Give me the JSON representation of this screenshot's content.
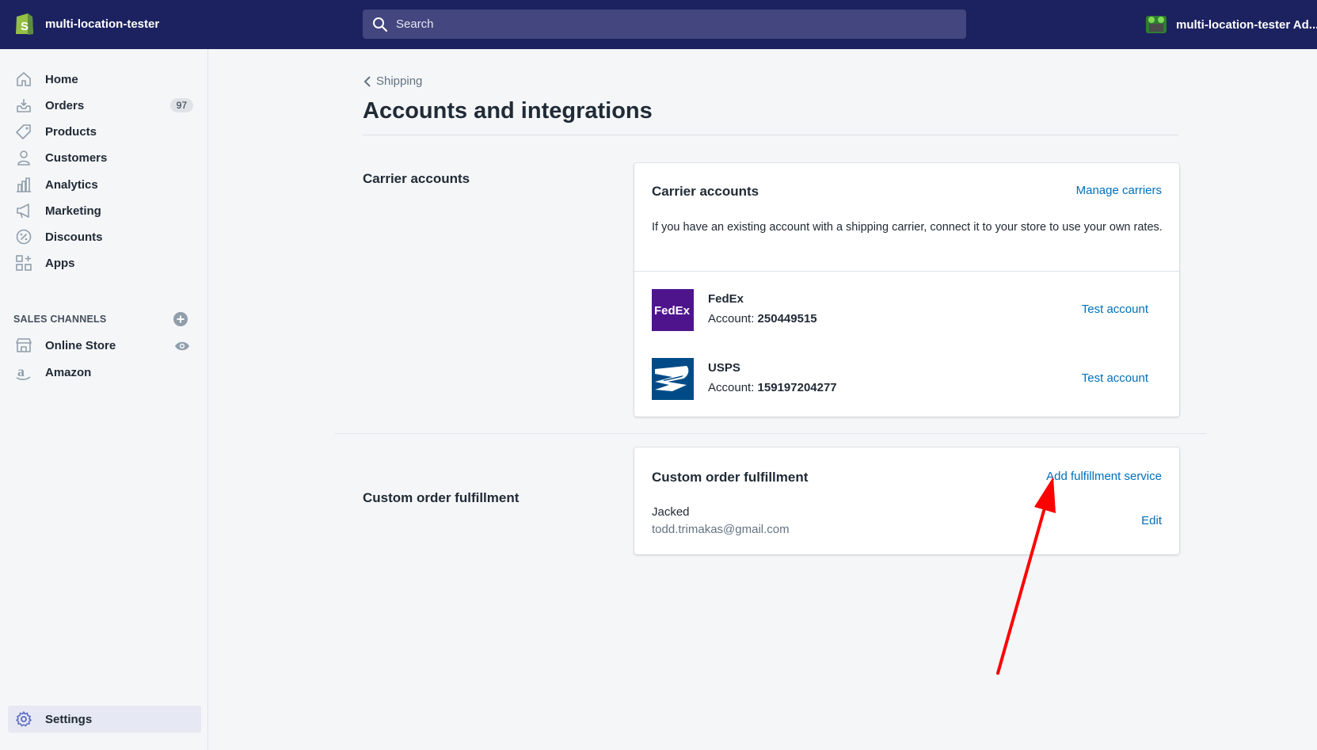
{
  "topbar": {
    "store_name": "multi-location-tester",
    "search_placeholder": "Search",
    "account_name": "multi-location-tester Ad..."
  },
  "sidebar": {
    "items": [
      {
        "label": "Home",
        "icon": "home-icon"
      },
      {
        "label": "Orders",
        "icon": "orders-icon",
        "badge": "97"
      },
      {
        "label": "Products",
        "icon": "tag-icon"
      },
      {
        "label": "Customers",
        "icon": "person-icon"
      },
      {
        "label": "Analytics",
        "icon": "bar-chart-icon"
      },
      {
        "label": "Marketing",
        "icon": "megaphone-icon"
      },
      {
        "label": "Discounts",
        "icon": "discount-icon"
      },
      {
        "label": "Apps",
        "icon": "apps-icon"
      }
    ],
    "sales_channels_title": "SALES CHANNELS",
    "channels": [
      {
        "label": "Online Store",
        "icon": "store-icon"
      },
      {
        "label": "Amazon",
        "icon": "amazon-icon"
      }
    ],
    "settings_label": "Settings"
  },
  "main": {
    "back_label": "Shipping",
    "page_title": "Accounts and integrations",
    "carrier_section": {
      "label": "Carrier accounts",
      "card_title": "Carrier accounts",
      "manage_link": "Manage carriers",
      "description": "If you have an existing account with a shipping carrier, connect it to your store to use your own rates.",
      "carriers": [
        {
          "name": "FedEx",
          "account_label": "Account:",
          "account_number": "250449515",
          "action": "Test account",
          "logo_text": "FedEx"
        },
        {
          "name": "USPS",
          "account_label": "Account:",
          "account_number": "159197204277",
          "action": "Test account"
        }
      ]
    },
    "fulfillment_section": {
      "label": "Custom order fulfillment",
      "card_title": "Custom order fulfillment",
      "add_link": "Add fulfillment service",
      "service_name": "Jacked",
      "service_email": "todd.trimakas@gmail.com",
      "edit_link": "Edit"
    }
  },
  "colors": {
    "topbar": "#1c2260",
    "link": "#006fbb",
    "annotation_arrow": "#ff0000",
    "fedex_purple": "#4d148c",
    "usps_blue": "#004b87"
  }
}
